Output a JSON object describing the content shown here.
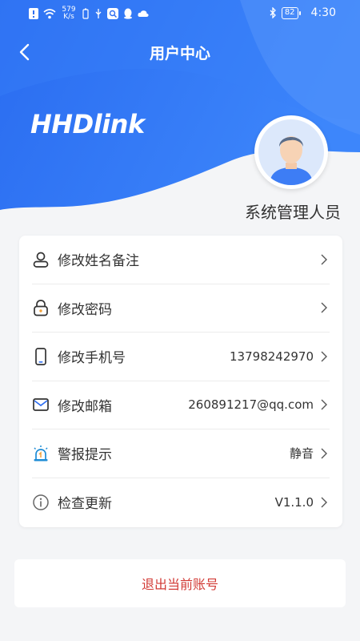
{
  "status_bar": {
    "speed_value": "579",
    "speed_unit": "K/s",
    "battery": "82",
    "time": "4:30"
  },
  "header": {
    "title": "用户中心",
    "logo_text": "HHDlink"
  },
  "profile": {
    "name": "系统管理人员"
  },
  "menu": [
    {
      "label": "修改姓名备注",
      "value": "",
      "icon": "user-icon"
    },
    {
      "label": "修改密码",
      "value": "",
      "icon": "lock-icon"
    },
    {
      "label": "修改手机号",
      "value": "13798242970",
      "icon": "phone-icon"
    },
    {
      "label": "修改邮箱",
      "value": "260891217@qq.com",
      "icon": "mail-icon"
    },
    {
      "label": "警报提示",
      "value": "静音",
      "icon": "alarm-icon"
    },
    {
      "label": "检查更新",
      "value": "V1.1.0",
      "icon": "info-icon"
    }
  ],
  "logout_label": "退出当前账号",
  "colors": {
    "brand_blue": "#2f6ff2",
    "logout_red": "#d23b36"
  }
}
